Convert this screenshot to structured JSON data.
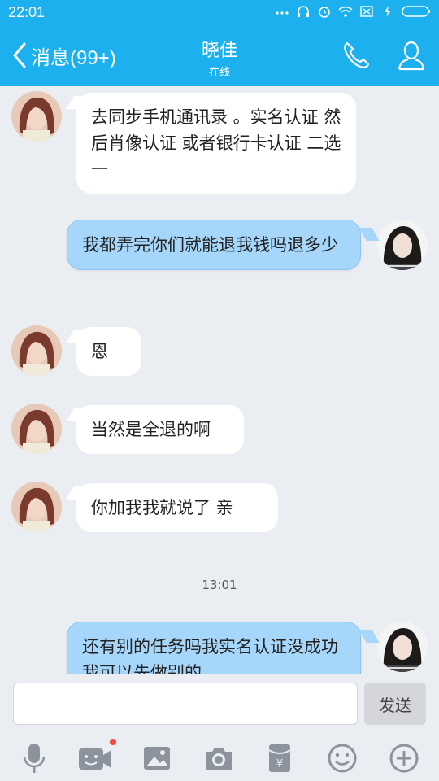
{
  "status_bar": {
    "time": "22:01",
    "icons": [
      "dots-icon",
      "headset-icon",
      "alarm-icon",
      "wifi-icon",
      "sim-icon",
      "charging-icon",
      "battery-icon"
    ]
  },
  "header": {
    "back_label": "消息(99+)",
    "title": "晓佳",
    "subtitle": "在线",
    "bg_color": "#1cb1ee"
  },
  "messages": [
    {
      "side": "in",
      "text": "去同步手机通讯录 。实名认证 然后肖像认证 或者银行卡认证 二选一"
    },
    {
      "side": "out",
      "text": "我都弄完你们就能退我钱吗退多少"
    },
    {
      "side": "in",
      "text": "恩"
    },
    {
      "side": "in",
      "text": "当然是全退的啊"
    },
    {
      "side": "in",
      "text": "你加我我就说了 亲"
    },
    {
      "side": "time",
      "text": "13:01"
    },
    {
      "side": "out",
      "text": "还有别的任务吗我实名认证没成功我可以先做别的"
    }
  ],
  "input": {
    "placeholder": "",
    "send_label": "发送"
  },
  "toolbar": {
    "icons": [
      "microphone-icon",
      "video-icon",
      "image-icon",
      "camera-icon",
      "red-packet-icon",
      "emoji-icon",
      "plus-icon"
    ],
    "badge_color": "#f04a3c"
  }
}
